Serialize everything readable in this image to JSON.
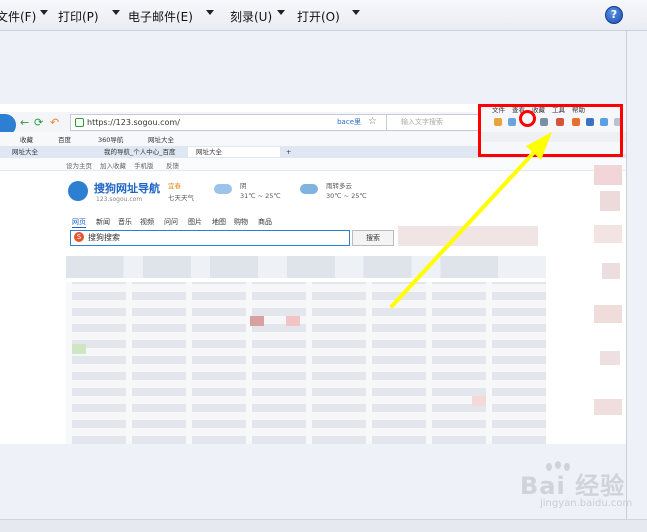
{
  "menu": {
    "items": [
      {
        "label": "文件(F)"
      },
      {
        "label": "打印(P)"
      },
      {
        "label": "电子邮件(E)"
      },
      {
        "label": "刻录(U)"
      },
      {
        "label": "打开(O)"
      }
    ],
    "help_icon": "help-icon",
    "help_glyph": "?"
  },
  "browser": {
    "url": "https://123.sogou.com/",
    "url_badge": "bace里",
    "search_placeholder": "输入文字搜索",
    "favorites": [
      "收藏",
      "百度",
      "360导航",
      "网址大全"
    ],
    "tabs": [
      {
        "label": "网址大全",
        "active": false
      },
      {
        "label": "我的导航_个人中心_百度",
        "active": false
      },
      {
        "label": "网址大全",
        "active": true
      }
    ],
    "subnav": [
      "设为主页",
      "加入收藏",
      "手机版",
      "反馈"
    ],
    "site_name": "搜狗网址导航",
    "site_domain": "123.sogou.com",
    "weather": [
      {
        "city": "宜春",
        "desc": "七天天气"
      },
      {
        "cond": "阴",
        "temp": "31℃ ~ 25℃"
      },
      {
        "cond": "雨转多云",
        "temp": "30℃ ~ 25℃"
      }
    ],
    "search_tabs": [
      "网页",
      "新闻",
      "音乐",
      "视频",
      "问问",
      "图片",
      "地图",
      "购物",
      "商品"
    ],
    "search_brand": "搜狗搜索",
    "search_button": "搜索",
    "toolbar_labels": [
      "文件",
      "查看",
      "收藏",
      "工具",
      "帮助"
    ]
  },
  "colors": {
    "highlight": "#ff0000",
    "arrow": "#ffff00",
    "brand": "#2d7fd1"
  },
  "watermark": {
    "brand": "Bai 经验",
    "url": "jingyan.baidu.com"
  }
}
